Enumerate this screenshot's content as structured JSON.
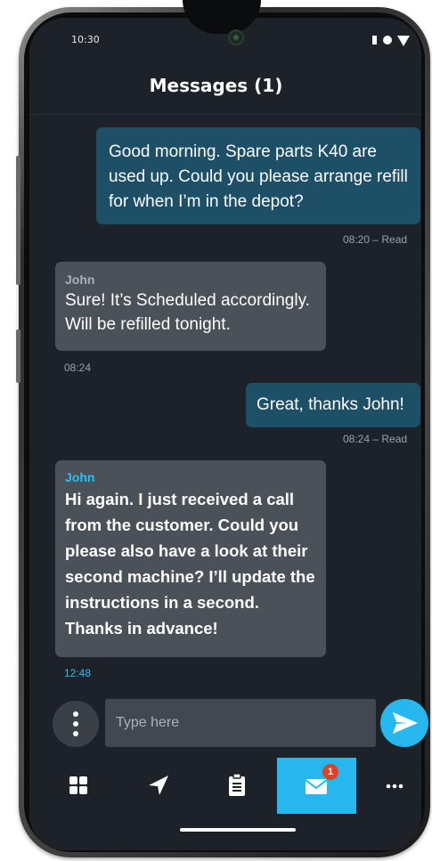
{
  "status_bar": {
    "time": "10:30"
  },
  "header": {
    "title": "Messages (1)"
  },
  "messages": [
    {
      "direction": "out",
      "text": "Good morning. Spare parts K40 are used up. Could you please arrange refill for when I’m in the depot?",
      "meta": "08:20 – Read"
    },
    {
      "direction": "in",
      "sender": "John",
      "text": "Sure! It’s Scheduled accordingly. Will be refilled tonight.",
      "meta": "08:24"
    },
    {
      "direction": "out",
      "text": "Great, thanks John!",
      "meta": "08:24 – Read"
    },
    {
      "direction": "in",
      "sender": "John",
      "unread": true,
      "text": "Hi again. I just received a call from the customer. Could you please also have a look at their second machine? I’ll update the instructions in a second. Thanks in advance!",
      "meta": "12:48"
    }
  ],
  "composer": {
    "placeholder": "Type here",
    "value": ""
  },
  "nav": {
    "items": [
      {
        "icon": "grid-icon",
        "active": false
      },
      {
        "icon": "navigation-arrow-icon",
        "active": false
      },
      {
        "icon": "clipboard-icon",
        "active": false
      },
      {
        "icon": "envelope-icon",
        "active": true,
        "badge": "1"
      },
      {
        "icon": "more-icon",
        "active": false
      }
    ]
  },
  "colors": {
    "accent": "#26b7ef",
    "background": "#1d2228",
    "outgoing_bubble": "#1d4f66",
    "incoming_bubble": "#4a5158",
    "badge": "#e64024"
  }
}
